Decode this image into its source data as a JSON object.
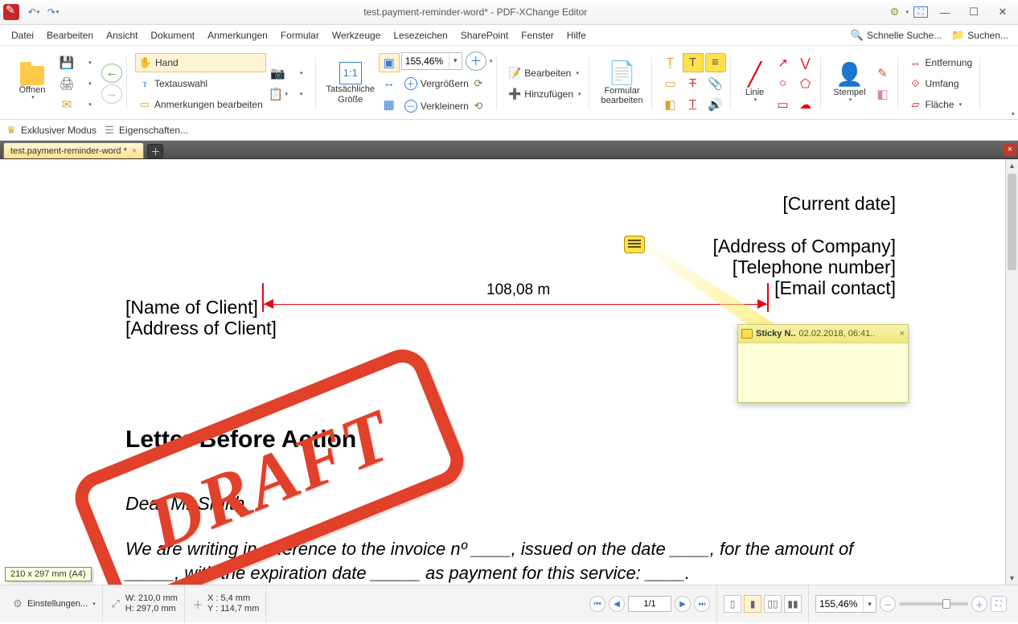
{
  "app": {
    "title": "test.payment-reminder-word* - PDF-XChange Editor"
  },
  "menus": {
    "datei": "Datei",
    "bearbeiten": "Bearbeiten",
    "ansicht": "Ansicht",
    "dokument": "Dokument",
    "anmerkungen": "Anmerkungen",
    "formular": "Formular",
    "werkzeuge": "Werkzeuge",
    "lesezeichen": "Lesezeichen",
    "sharepoint": "SharePoint",
    "fenster": "Fenster",
    "hilfe": "Hilfe"
  },
  "search": {
    "schnelle": "Schnelle Suche...",
    "suchen": "Suchen..."
  },
  "ribbon": {
    "oeffnen": "Öffnen",
    "hand": "Hand",
    "textauswahl": "Textauswahl",
    "anmerkungen_bearbeiten": "Anmerkungen bearbeiten",
    "tatsaechliche": "Tatsächliche Größe",
    "zoom": "155,46%",
    "vergroessern": "Vergrößern",
    "verkleinern": "Verkleinern",
    "bearbeiten": "Bearbeiten",
    "hinzufuegen": "Hinzufügen",
    "formular_bearbeiten": "Formular bearbeiten",
    "linie": "Linie",
    "stempel": "Stempel",
    "entfernung": "Entfernung",
    "umfang": "Umfang",
    "flaeche": "Fläche"
  },
  "subbar": {
    "exklusiv": "Exklusiver Modus",
    "eigenschaften": "Eigenschaften..."
  },
  "tab": {
    "name": "test.payment-reminder-word *"
  },
  "doc": {
    "date": "[Current date]",
    "company": "[Address of Company]",
    "tel": "[Telephone number]",
    "email": "[Email contact]",
    "client_name": "[Name of Client]",
    "client_addr": "[Address of Client]",
    "measure": "108,08 m",
    "heading": "Letter Before Action",
    "greeting": "Dear Mr Smith",
    "body1": "We are writing in reference to the invoice nº ____, issued on the date ____, for the amount of _____, with the expiration date _____  as payment for this service: ____.",
    "stamp": "DRAFT"
  },
  "sticky": {
    "title": "Sticky N..",
    "date": "02.02.2018, 06:41.."
  },
  "status": {
    "einstellungen": "Einstellungen...",
    "w": "W:  210,0 mm",
    "h": "H:  297,0 mm",
    "x": "X :    5,4 mm",
    "y": "Y :  114,7 mm",
    "page": "1/1",
    "zoom": "155,46%",
    "tooltip": "210 x 297 mm (A4)"
  }
}
